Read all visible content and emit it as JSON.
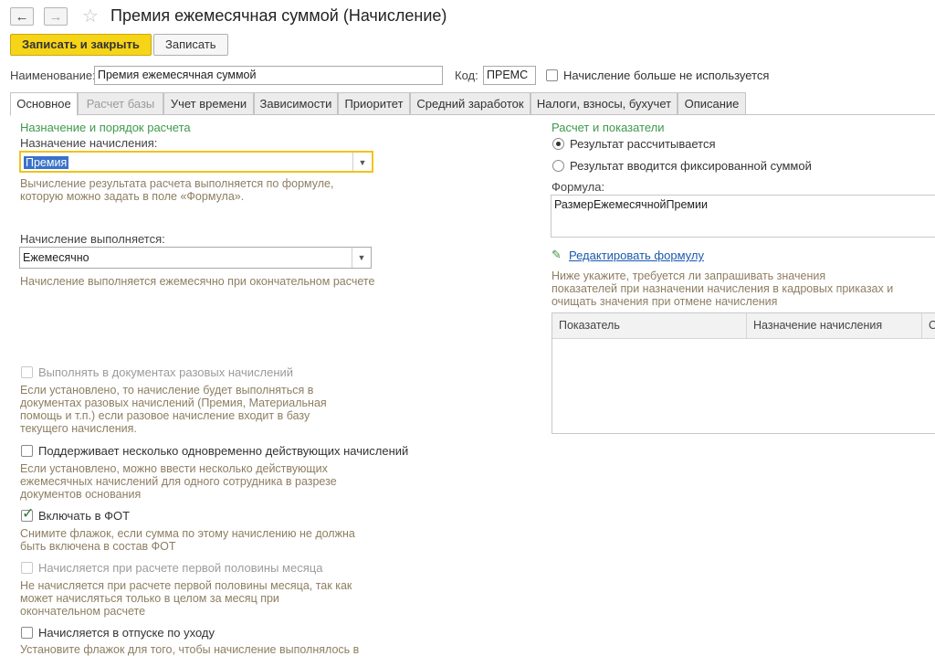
{
  "window": {
    "back_icon": "arrow-left-icon",
    "forward_icon": "arrow-right-icon",
    "favorite_icon": "star-icon",
    "title": "Премия ежемесячная суммой (Начисление)"
  },
  "toolbar": {
    "save_close_label": "Записать и закрыть",
    "save_label": "Записать"
  },
  "header": {
    "name_label": "Наименование:",
    "name_value": "Премия ежемесячная суммой",
    "code_label": "Код:",
    "code_value": "ПРЕМС",
    "unused_label": "Начисление больше не используется"
  },
  "tabs": [
    {
      "label": "Основное"
    },
    {
      "label": "Расчет базы"
    },
    {
      "label": "Учет времени"
    },
    {
      "label": "Зависимости"
    },
    {
      "label": "Приоритет"
    },
    {
      "label": "Средний заработок"
    },
    {
      "label": "Налоги, взносы, бухучет"
    },
    {
      "label": "Описание"
    }
  ],
  "left": {
    "section_title": "Назначение и порядок расчета",
    "purpose_label": "Назначение начисления:",
    "purpose_value": "Премия",
    "purpose_hint_1": "Вычисление результата расчета выполняется по формуле,",
    "purpose_hint_2": "которую можно задать в поле «Формула».",
    "period_label": "Начисление выполняется:",
    "period_value": "Ежемесячно",
    "period_hint": "Начисление выполняется ежемесячно при окончательном расчете",
    "cb_onetime_label": "Выполнять в документах разовых начислений",
    "cb_onetime_hint": [
      "Если установлено, то начисление будет выполняться в",
      "документах разовых начислений (Премия, Материальная",
      "помощь и т.п.) если разовое начисление входит в базу",
      "текущего начисления."
    ],
    "cb_multi_label": "Поддерживает несколько одновременно действующих начислений",
    "cb_multi_hint": [
      "Если установлено, можно ввести несколько действующих",
      "ежемесячных начислений для одного сотрудника в разрезе",
      "документов основания"
    ],
    "cb_fot_label": "Включать в ФОТ",
    "cb_fot_hint": [
      "Снимите флажок, если сумма по этому начислению не должна",
      "быть включена в состав ФОТ"
    ],
    "cb_half_label": "Начисляется при расчете первой половины месяца",
    "cb_half_hint": [
      "Не начисляется при расчете первой половины месяца, так как",
      "может начисляться только в целом за месяц при",
      "окончательном расчете"
    ],
    "cb_leave_label": "Начисляется в отпуске по уходу",
    "cb_leave_hint": "Установите флажок для того, чтобы начисление выполнялось в"
  },
  "right": {
    "section_title": "Расчет и показатели",
    "radio_calc_label": "Результат рассчитывается",
    "radio_fixed_label": "Результат вводится фиксированной суммой",
    "formula_label": "Формула:",
    "formula_value": "РазмерЕжемесячнойПремии",
    "edit_icon": "pencil-icon",
    "edit_formula_link": "Редактировать формулу",
    "indicators_hint": [
      "Ниже укажите, требуется ли запрашивать значения",
      "показателей при назначении начисления в кадровых приказах и",
      "очищать значения при отмене начисления"
    ],
    "grid_columns": [
      "Показатель",
      "Назначение начисления",
      "О"
    ]
  },
  "checkbox_states": {
    "unused": false,
    "onetime": false,
    "multi": false,
    "fot": true,
    "half": false,
    "leave": false
  },
  "colors": {
    "primary_button": "#f6d417",
    "section_title": "#3d9a4b",
    "hint_text": "#8d7e62",
    "link": "#1b5ab0",
    "checkmark": "#2f7a35",
    "focus_border": "#f0c419"
  }
}
